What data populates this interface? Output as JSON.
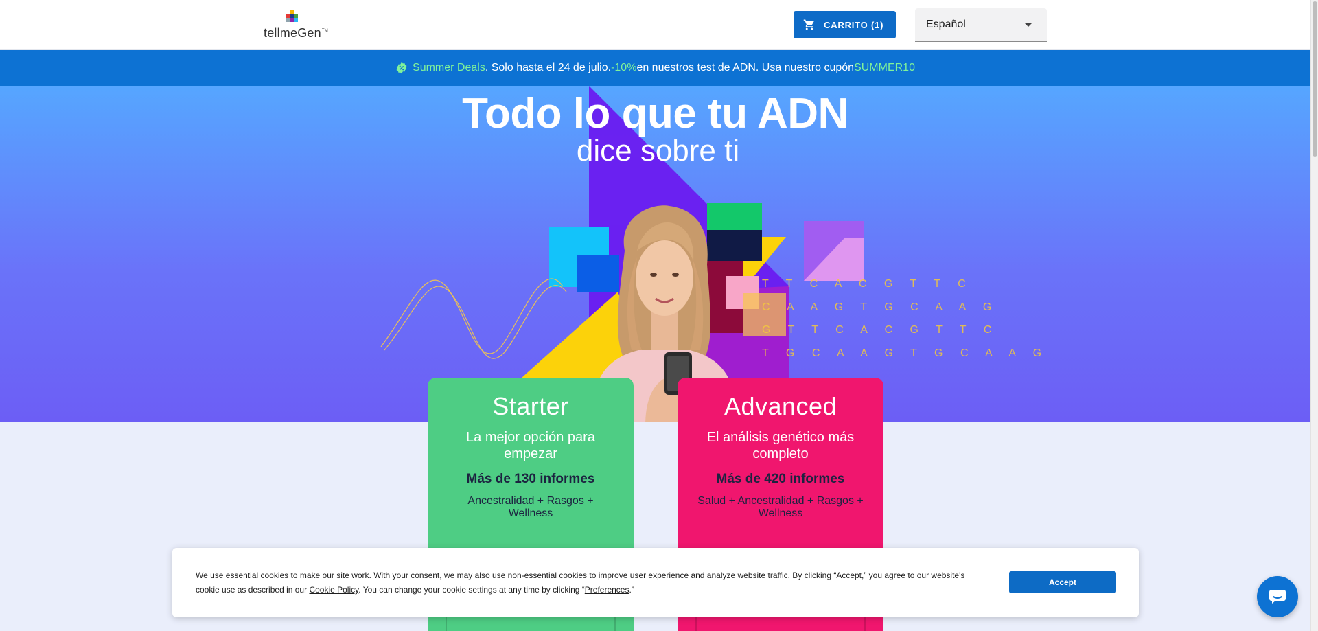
{
  "header": {
    "logo_text": "tellmeGen",
    "logo_tm": "TM",
    "cart_label": "CARRITO (1)",
    "language": "Español",
    "icons": {
      "cart": "shopping-cart-icon",
      "dropdown": "chevron-down-icon"
    }
  },
  "promo": {
    "highlight": "Summer Deals",
    "text_1": ". Solo hasta el 24 de julio. ",
    "discount": "-10%",
    "text_2": " en nuestros test de ADN. Usa nuestro cupón ",
    "coupon": "SUMMER10",
    "icon": "discount-badge-icon"
  },
  "hero": {
    "title": "Todo lo que tu ADN",
    "subtitle": "dice sobre ti",
    "dna_rows": [
      "T T C A C G T T C",
      "C A A G T G C A A G",
      "G T T C A C G T T C",
      "T G C A A G T G C A A G"
    ]
  },
  "products": [
    {
      "name": "Starter",
      "tagline": "La mejor opción para empezar",
      "reports": "Más de 130 informes",
      "description": "Ancestralidad + Rasgos + Wellness"
    },
    {
      "name": "Advanced",
      "tagline": "El análisis genético más completo",
      "reports": "Más de 420 informes",
      "description": "Salud + Ancestralidad + Rasgos + Wellness"
    }
  ],
  "cookie": {
    "text_1": "We use essential cookies to make our site work. With your consent, we may also use non-essential cookies to improve user experience and analyze website traffic. By clicking “Accept,” you agree to our website's cookie use as described in our ",
    "policy_link": "Cookie Policy",
    "text_2": ". You can change your cookie settings at any time by clicking “",
    "preferences_link": "Preferences",
    "text_3": ".”",
    "accept_label": "Accept"
  },
  "chat": {
    "icon": "chat-bubble-icon"
  },
  "colors": {
    "brand_blue": "#0d72d3",
    "promo_highlight": "#7ff29a",
    "starter_green": "#4ecd84",
    "advanced_pink": "#f0166e"
  }
}
